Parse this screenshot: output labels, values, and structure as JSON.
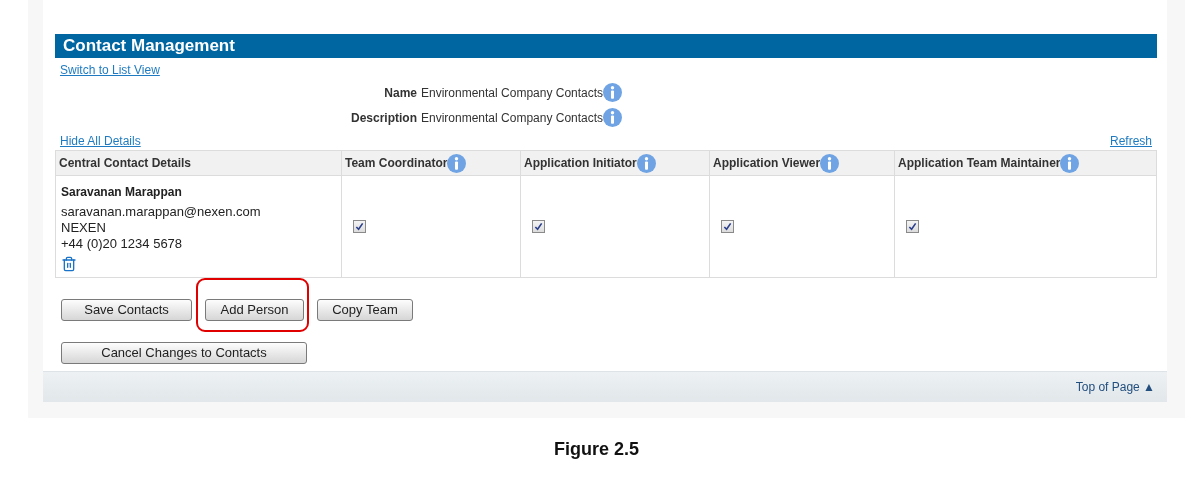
{
  "header": {
    "title": "Contact Management"
  },
  "links": {
    "switch_view": "Switch to List View",
    "hide_details": "Hide All Details",
    "refresh": "Refresh"
  },
  "fields": [
    {
      "label": "Name",
      "value": "Environmental Company Contacts"
    },
    {
      "label": "Description",
      "value": "Environmental Company Contacts"
    }
  ],
  "table": {
    "columns": [
      {
        "label": "Central Contact Details",
        "info": false
      },
      {
        "label": "Team Coordinator",
        "info": true
      },
      {
        "label": "Application Initiator",
        "info": true
      },
      {
        "label": "Application Viewer",
        "info": true
      },
      {
        "label": "Application Team Maintainer",
        "info": true
      }
    ],
    "rows": [
      {
        "name": "Saravanan Marappan",
        "email": "saravanan.marappan@nexen.com",
        "company": "NEXEN",
        "phone": "+44 (0)20 1234 5678",
        "roles": [
          {
            "checked": true
          },
          {
            "checked": true
          },
          {
            "checked": true
          },
          {
            "checked": true
          }
        ]
      }
    ]
  },
  "buttons": [
    {
      "label": "Save Contacts",
      "highlighted": false
    },
    {
      "label": "Add Person",
      "highlighted": true
    },
    {
      "label": "Copy Team",
      "highlighted": false
    }
  ],
  "cancel_button": {
    "label": "Cancel Changes to Contacts"
  },
  "footer": {
    "top_link": "Top of Page ▲"
  },
  "caption": "Figure 2.5"
}
